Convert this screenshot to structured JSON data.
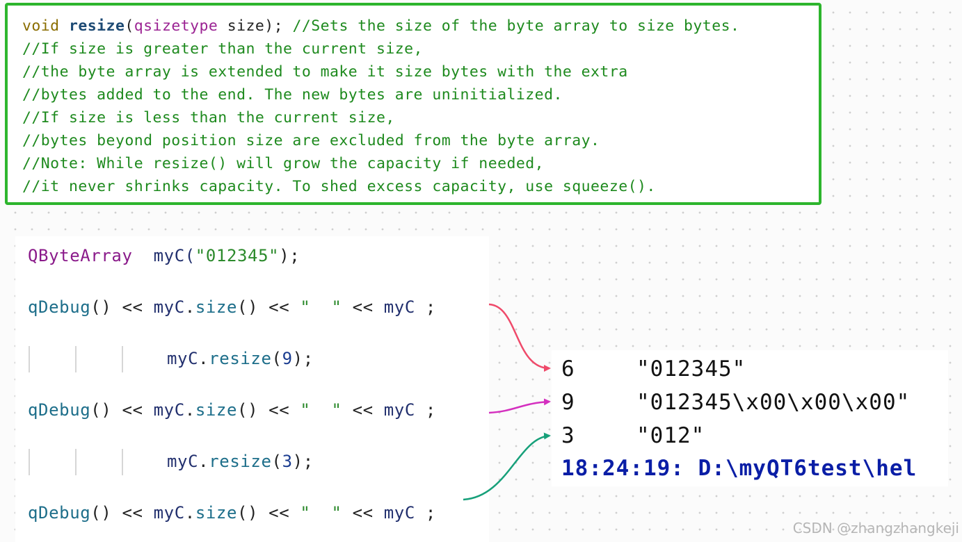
{
  "doc_comment": {
    "line1": {
      "keyword": "void",
      "function": "resize",
      "open_paren": "(",
      "param_type": "qsizetype",
      "param_rest": " size);",
      "comment": " //Sets the size of the byte array to size bytes."
    },
    "lines": [
      "//If size is greater than the current size,",
      "//the byte array is extended to make it size bytes with the extra",
      "//bytes added to the end. The new bytes are uninitialized.",
      "//If size is less than the current size,",
      "//bytes beyond position size are excluded from the byte array.",
      "//Note: While resize() will grow the capacity if needed,",
      "//it never shrinks capacity. To shed excess capacity, use squeeze()."
    ]
  },
  "code": {
    "decl": {
      "type": "QByteArray",
      "rest_a": "  myC(",
      "literal": "\"012345\"",
      "rest_b": ");"
    },
    "debug": {
      "fn": "qDebug",
      "a": "() << ",
      "var": "myC",
      "b": ".",
      "size": "size",
      "c": "() << ",
      "str": "\"  \"",
      "d": " << ",
      "var2": "myC",
      "e": " ;"
    },
    "resize1": {
      "var": "myC",
      "dot": ".",
      "fn": "resize",
      "open": "(",
      "num": "9",
      "close": ");"
    },
    "resize2": {
      "var": "myC",
      "dot": ".",
      "fn": "resize",
      "open": "(",
      "num": "3",
      "close": ");"
    }
  },
  "output": {
    "rows": [
      {
        "size": "6",
        "value": "\"012345\""
      },
      {
        "size": "9",
        "value": "\"012345\\x00\\x00\\x00\""
      },
      {
        "size": "3",
        "value": "\"012\""
      }
    ],
    "status_line": "18:24:19: D:\\myQT6test\\hel"
  },
  "arrow_colors": [
    "#ef4a6a",
    "#d42fbf",
    "#17a07a"
  ],
  "watermark": "CSDN @zhangzhangkeji"
}
